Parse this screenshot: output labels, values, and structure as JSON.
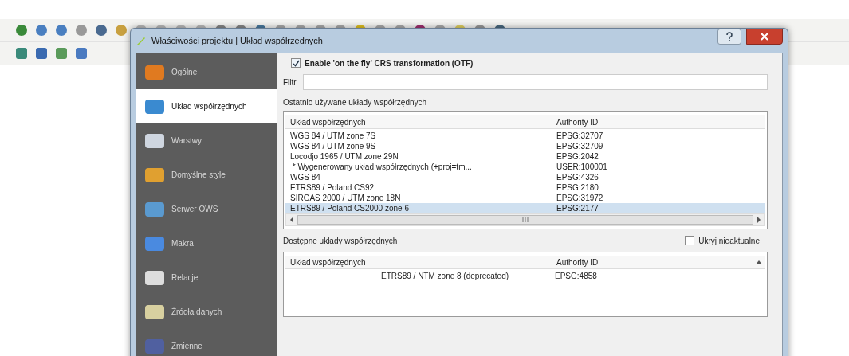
{
  "dialog": {
    "title": "Właściwości projektu | Układ współrzędnych"
  },
  "sidebar": {
    "items": [
      {
        "label": "Ogólne",
        "selected": false
      },
      {
        "label": "Układ współrzędnych",
        "selected": true
      },
      {
        "label": "Warstwy",
        "selected": false
      },
      {
        "label": "Domyślne style",
        "selected": false
      },
      {
        "label": "Serwer OWS",
        "selected": false
      },
      {
        "label": "Makra",
        "selected": false
      },
      {
        "label": "Relacje",
        "selected": false
      },
      {
        "label": "Źródła danych",
        "selected": false
      },
      {
        "label": "Zmienne",
        "selected": false
      }
    ]
  },
  "otf": {
    "label": "Enable 'on the fly' CRS transformation (OTF)",
    "checked": true
  },
  "filter": {
    "label": "Filtr"
  },
  "recent": {
    "label": "Ostatnio używane układy współrzędnych",
    "columns": [
      "Układ współrzędnych",
      "Authority ID"
    ],
    "rows": [
      {
        "name": "WGS 84 / UTM zone 7S",
        "id": "EPSG:32707",
        "selected": false
      },
      {
        "name": "WGS 84 / UTM zone 9S",
        "id": "EPSG:32709",
        "selected": false
      },
      {
        "name": "Locodjo 1965 / UTM zone 29N",
        "id": "EPSG:2042",
        "selected": false
      },
      {
        "name": " * Wygenerowany układ współrzędnych (+proj=tm...",
        "id": "USER:100001",
        "selected": false
      },
      {
        "name": "WGS 84",
        "id": "EPSG:4326",
        "selected": false
      },
      {
        "name": "ETRS89 / Poland CS92",
        "id": "EPSG:2180",
        "selected": false
      },
      {
        "name": "SIRGAS 2000 / UTM zone 18N",
        "id": "EPSG:31972",
        "selected": false
      },
      {
        "name": "ETRS89 / Poland CS2000 zone 6",
        "id": "EPSG:2177",
        "selected": true
      }
    ]
  },
  "available": {
    "label": "Dostępne układy współrzędnych",
    "hide_deprecated": {
      "label": "Ukryj nieaktualne",
      "checked": false
    },
    "columns": [
      "Układ współrzędnych",
      "Authority ID"
    ],
    "rows": [
      {
        "name": "ETRS89 / NTM zone 8 (deprecated)",
        "id": "EPSG:4858"
      }
    ]
  }
}
